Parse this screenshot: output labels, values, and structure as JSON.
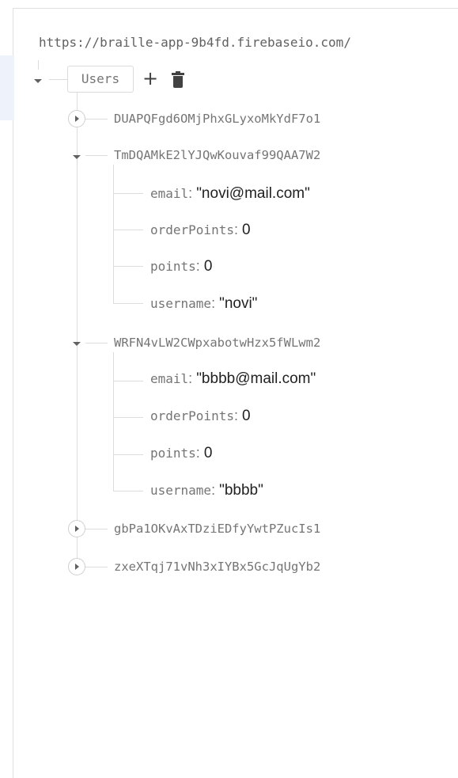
{
  "database": {
    "url": "https://braille-app-9b4fd.firebaseio.com/",
    "root_node": "Users",
    "add_symbol": "+"
  },
  "children": [
    {
      "key": "DUAPQFgd6OMjPhxGLyxoMkYdF7o1",
      "state": "collapsed"
    },
    {
      "key": "TmDQAMkE2lYJQwKouvaf99QAA7W2",
      "state": "expanded",
      "fields": [
        {
          "key": "email",
          "value": "\"novi@mail.com\""
        },
        {
          "key": "orderPoints",
          "value": "0"
        },
        {
          "key": "points",
          "value": "0"
        },
        {
          "key": "username",
          "value": "\"novi\""
        }
      ]
    },
    {
      "key": "WRFN4vLW2CWpxabotwHzx5fWLwm2",
      "state": "expanded",
      "fields": [
        {
          "key": "email",
          "value": "\"bbbb@mail.com\""
        },
        {
          "key": "orderPoints",
          "value": "0"
        },
        {
          "key": "points",
          "value": "0"
        },
        {
          "key": "username",
          "value": "\"bbbb\""
        }
      ]
    },
    {
      "key": "gbPa1OKvAxTDziEDfyYwtPZucIs1",
      "state": "collapsed"
    },
    {
      "key": "zxeXTqj71vNh3xIYBx5GcJqUgYb2",
      "state": "collapsed"
    }
  ],
  "separator": ": "
}
